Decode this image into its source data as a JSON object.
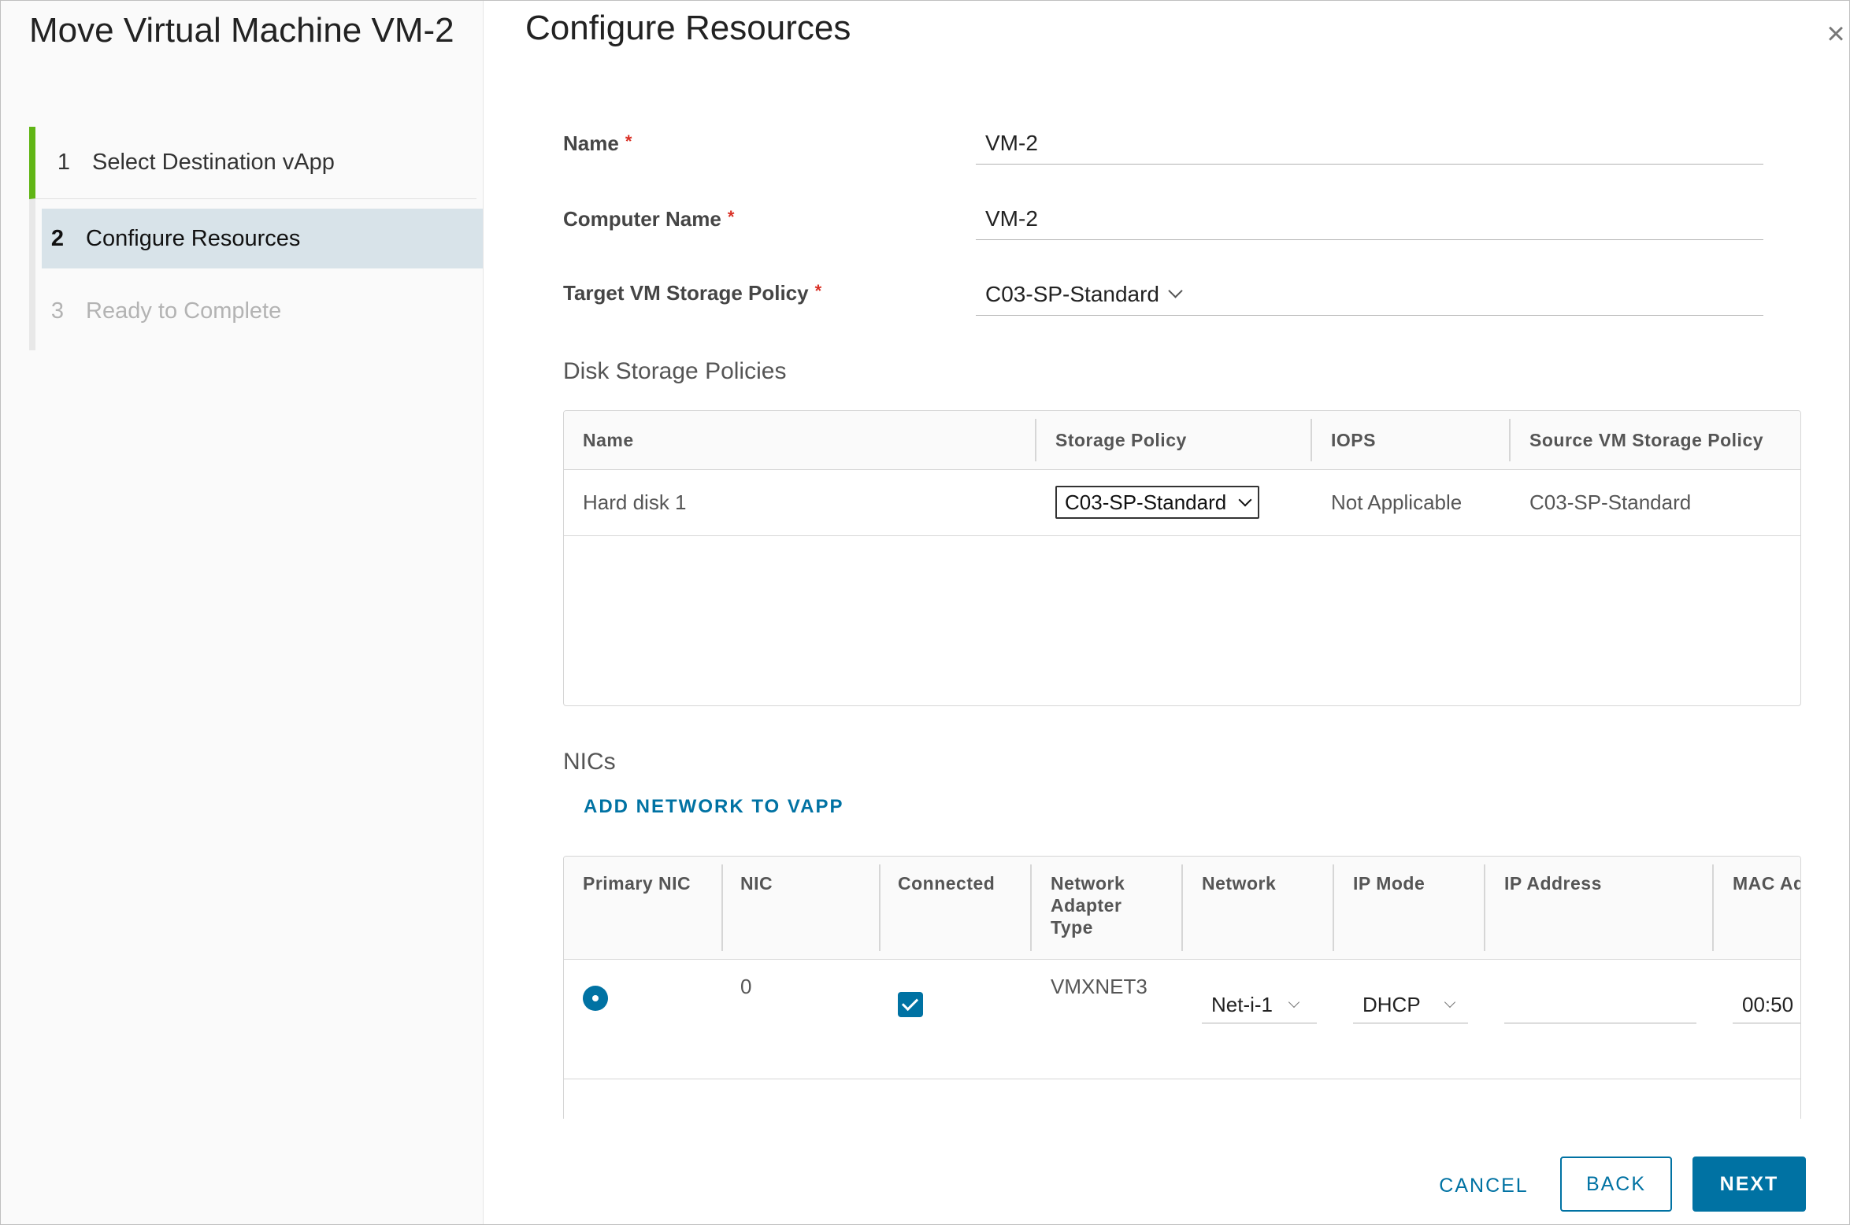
{
  "wizard": {
    "title": "Move Virtual Machine VM-2",
    "steps": [
      {
        "num": "1",
        "label": "Select Destination vApp",
        "state": "done"
      },
      {
        "num": "2",
        "label": "Configure Resources",
        "state": "active"
      },
      {
        "num": "3",
        "label": "Ready to Complete",
        "state": "pending"
      }
    ]
  },
  "page": {
    "title": "Configure Resources",
    "close_icon": "×"
  },
  "form": {
    "name_label": "Name",
    "name_value": "VM-2",
    "computer_name_label": "Computer Name",
    "computer_name_value": "VM-2",
    "storage_policy_label": "Target VM Storage Policy",
    "storage_policy_value": "C03-SP-Standard",
    "required_marker": "*"
  },
  "disk_section": {
    "title": "Disk Storage Policies",
    "columns": [
      "Name",
      "Storage Policy",
      "IOPS",
      "Source VM Storage Policy"
    ],
    "rows": [
      {
        "name": "Hard disk 1",
        "storage_policy": "C03-SP-Standard",
        "iops": "Not Applicable",
        "source_policy": "C03-SP-Standard"
      }
    ]
  },
  "nic_section": {
    "title": "NICs",
    "add_network_label": "ADD NETWORK TO VAPP",
    "columns": [
      "Primary NIC",
      "NIC",
      "Connected",
      "Network Adapter Type",
      "Network",
      "IP Mode",
      "IP Address",
      "MAC Ad"
    ],
    "rows": [
      {
        "primary": true,
        "nic": "0",
        "connected": true,
        "adapter_type": "VMXNET3",
        "network": "Net-i-1",
        "ip_mode": "DHCP",
        "ip_address": "",
        "mac": "00:50"
      }
    ]
  },
  "footer": {
    "cancel_label": "CANCEL",
    "back_label": "BACK",
    "next_label": "NEXT"
  },
  "colors": {
    "accent": "#0072a3",
    "step_done": "#60b515",
    "step_active_bg": "#d8e3e9",
    "required": "#d93025"
  }
}
